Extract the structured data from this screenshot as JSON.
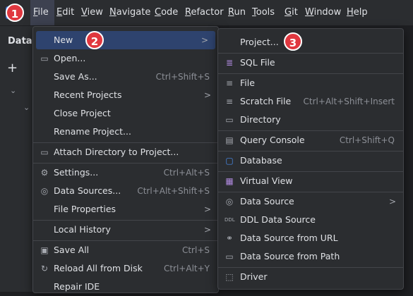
{
  "menubar": {
    "items": [
      {
        "label": "File",
        "mn": "F",
        "rest": "ile"
      },
      {
        "label": "Edit",
        "mn": "E",
        "rest": "dit"
      },
      {
        "label": "View",
        "mn": "V",
        "rest": "iew"
      },
      {
        "label": "Navigate",
        "mn": "N",
        "rest": "avigate"
      },
      {
        "label": "Code",
        "mn": "C",
        "rest": "ode"
      },
      {
        "label": "Refactor",
        "mn": "R",
        "rest": "efactor"
      },
      {
        "label": "Run",
        "mn": "R",
        "rest": "un"
      },
      {
        "label": "Tools",
        "mn": "T",
        "rest": "ools"
      },
      {
        "label": "Git",
        "mn": "G",
        "rest": "it"
      },
      {
        "label": "Window",
        "mn": "W",
        "rest": "indow"
      },
      {
        "label": "Help",
        "mn": "H",
        "rest": "elp"
      }
    ]
  },
  "left_panel": {
    "title": "Datal"
  },
  "file_menu": {
    "items": [
      {
        "label": "New",
        "shortcut": "",
        "submenu": true
      },
      {
        "label": "Open...",
        "shortcut": "",
        "icon": "folder-icon"
      },
      {
        "label": "Save As...",
        "shortcut": "Ctrl+Shift+S"
      },
      {
        "label": "Recent Projects",
        "shortcut": "",
        "submenu": true
      },
      {
        "label": "Close Project",
        "shortcut": ""
      },
      {
        "label": "Rename Project...",
        "shortcut": ""
      },
      {
        "label": "Attach Directory to Project...",
        "shortcut": "",
        "icon": "attach-folder-icon"
      },
      {
        "label": "Settings...",
        "shortcut": "Ctrl+Alt+S",
        "icon": "gear-icon"
      },
      {
        "label": "Data Sources...",
        "shortcut": "Ctrl+Alt+Shift+S",
        "icon": "data-sources-icon"
      },
      {
        "label": "File Properties",
        "shortcut": "",
        "submenu": true
      },
      {
        "label": "Local History",
        "shortcut": "",
        "submenu": true
      },
      {
        "label": "Save All",
        "shortcut": "Ctrl+S",
        "icon": "save-icon"
      },
      {
        "label": "Reload All from Disk",
        "shortcut": "Ctrl+Alt+Y",
        "icon": "reload-icon"
      },
      {
        "label": "Repair IDE",
        "shortcut": ""
      }
    ]
  },
  "new_menu": {
    "items": [
      {
        "label": "Project...",
        "shortcut": ""
      },
      {
        "label": "SQL File",
        "shortcut": "",
        "icon": "sql-file-icon"
      },
      {
        "label": "File",
        "shortcut": "",
        "icon": "file-icon"
      },
      {
        "label": "Scratch File",
        "shortcut": "Ctrl+Alt+Shift+Insert",
        "icon": "scratch-file-icon"
      },
      {
        "label": "Directory",
        "shortcut": "",
        "icon": "folder-icon"
      },
      {
        "label": "Query Console",
        "shortcut": "Ctrl+Shift+Q",
        "icon": "console-icon"
      },
      {
        "label": "Database",
        "shortcut": "",
        "icon": "database-icon"
      },
      {
        "label": "Virtual View",
        "shortcut": "",
        "icon": "virtual-view-icon"
      },
      {
        "label": "Data Source",
        "shortcut": "",
        "submenu": true,
        "icon": "data-source-icon"
      },
      {
        "label": "DDL Data Source",
        "shortcut": "",
        "icon": "ddl-icon"
      },
      {
        "label": "Data Source from URL",
        "shortcut": "",
        "icon": "url-icon"
      },
      {
        "label": "Data Source from Path",
        "shortcut": "",
        "icon": "folder-icon"
      },
      {
        "label": "Driver",
        "shortcut": "",
        "icon": "driver-icon"
      }
    ]
  },
  "badges": [
    "1",
    "2",
    "3"
  ],
  "colors": {
    "accent": "#2e436e",
    "badge": "#e0373f",
    "menu_bg": "#2b2d30",
    "bg": "#1e1f22"
  }
}
